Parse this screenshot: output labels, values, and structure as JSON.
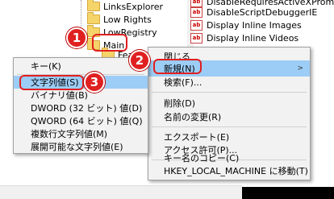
{
  "tree": {
    "items": [
      {
        "label": "LinksExplorer"
      },
      {
        "label": "Low Rights"
      },
      {
        "label": "LowRegistry"
      },
      {
        "label": "Main"
      },
      {
        "label": "Featu"
      }
    ]
  },
  "values": {
    "items": [
      {
        "name": "DisableRequiresActiveXPrompt"
      },
      {
        "name": "DisableScriptDebuggerIE"
      },
      {
        "name": "Display Inline Images"
      },
      {
        "name": "Display Inline Videos"
      }
    ]
  },
  "context_menu": {
    "items": [
      {
        "label": "閉じる"
      },
      {
        "label": "新規(N)"
      },
      {
        "label": "検索(F)..."
      },
      {
        "label": "削除(D)"
      },
      {
        "label": "名前の変更(R)"
      },
      {
        "label": "エクスポート(E)"
      },
      {
        "label": "アクセス許可(P)..."
      },
      {
        "label": "キー名のコピー(C)"
      },
      {
        "label": "HKEY_LOCAL_MACHINE に移動(T)"
      }
    ],
    "submenu_arrow": ">"
  },
  "submenu": {
    "items": [
      {
        "label": "キー(K)"
      },
      {
        "label": "文字列値(S)"
      },
      {
        "label": "バイナリ値(B)"
      },
      {
        "label": "DWORD (32 ビット) 値(D)"
      },
      {
        "label": "QWORD (64 ビット) 値(Q)"
      },
      {
        "label": "複数行文字列値(M)"
      },
      {
        "label": "展開可能な文字列値(E)"
      }
    ]
  },
  "callouts": {
    "step1": "1",
    "step2": "2",
    "step3": "3"
  },
  "colors": {
    "highlight": "#9ccdf6",
    "callout": "#e02020",
    "menu_bg": "#f2f2f2"
  }
}
